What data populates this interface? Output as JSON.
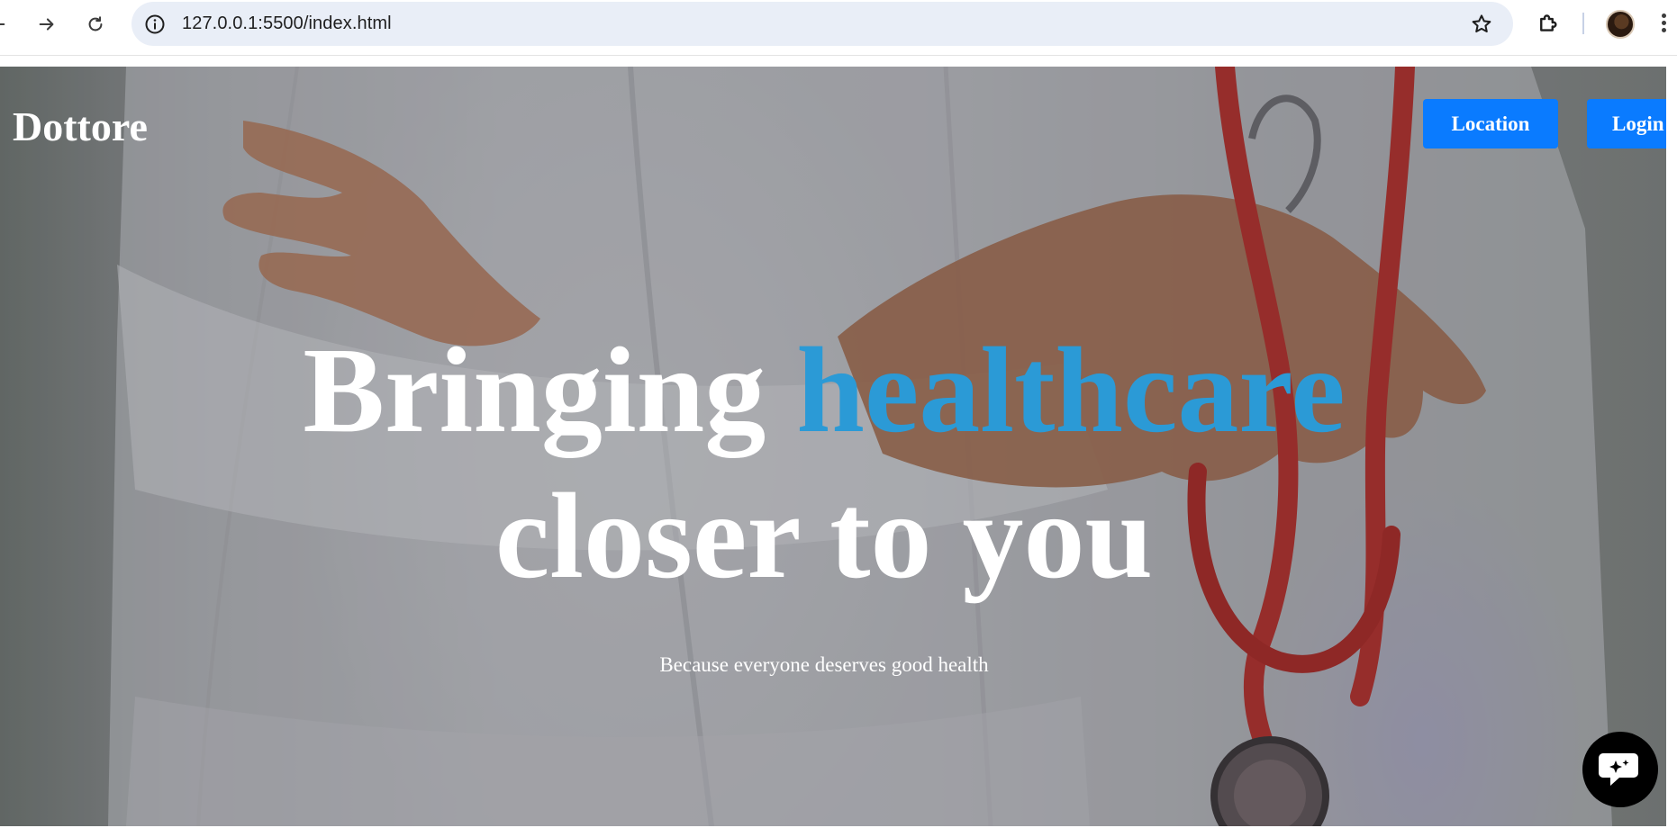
{
  "browser": {
    "url": "127.0.0.1:5500/index.html"
  },
  "header": {
    "brand": "Dottore",
    "buttons": {
      "location": "Location",
      "login": "Login"
    }
  },
  "hero": {
    "headline_part1": "Bringing ",
    "headline_accent": "healthcare",
    "headline_line2": "closer to you",
    "tagline": "Because everyone deserves good health"
  },
  "colors": {
    "accent": "#2b9ad6",
    "button": "#0a7bff",
    "chat_button": "#000000"
  },
  "icons": {
    "chat": "chat-bubble-icon",
    "back": "back-arrow-icon",
    "forward": "forward-arrow-icon",
    "reload": "reload-icon",
    "info": "info-icon",
    "bookmark": "star-icon",
    "extensions": "puzzle-icon"
  }
}
